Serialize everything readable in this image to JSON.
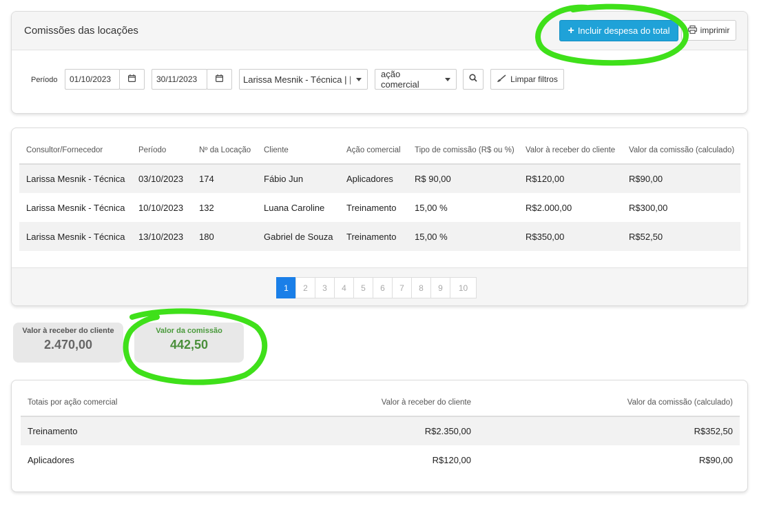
{
  "header": {
    "title": "Comissões das locações",
    "add_expense_label": "Incluir despesa do total",
    "print_label": "imprimir"
  },
  "filters": {
    "period_label": "Período",
    "start_date": "01/10/2023",
    "end_date": "30/11/2023",
    "consultant_select": "Larissa Mesnik - Técnica | |×",
    "action_select": "ação comercial",
    "clear_label": "Limpar filtros"
  },
  "table": {
    "columns": [
      "Consultor/Fornecedor",
      "Período",
      "Nº da Locação",
      "Cliente",
      "Ação comercial",
      "Tipo de comissão (R$ ou %)",
      "Valor à receber do cliente",
      "Valor da comissão (calculado)"
    ],
    "rows": [
      [
        "Larissa Mesnik - Técnica",
        "03/10/2023",
        "174",
        "Fábio Jun",
        "Aplicadores",
        "R$ 90,00",
        "R$120,00",
        "R$90,00"
      ],
      [
        "Larissa Mesnik - Técnica",
        "10/10/2023",
        "132",
        "Luana Caroline",
        "Treinamento",
        "15,00 %",
        "R$2.000,00",
        "R$300,00"
      ],
      [
        "Larissa Mesnik - Técnica",
        "13/10/2023",
        "180",
        "Gabriel de Souza",
        "Treinamento",
        "15,00 %",
        "R$350,00",
        "R$52,50"
      ]
    ]
  },
  "pagination": {
    "pages": [
      "1",
      "2",
      "3",
      "4",
      "5",
      "6",
      "7",
      "8",
      "9",
      "10"
    ],
    "current": "1"
  },
  "summary": {
    "receber_label": "Valor à receber do cliente",
    "receber_value": "2.470,00",
    "comissao_label": "Valor da comissão",
    "comissao_value": "442,50"
  },
  "totals": {
    "columns": [
      "Totais por ação comercial",
      "Valor à receber do cliente",
      "Valor da comissão (calculado)"
    ],
    "rows": [
      [
        "Treinamento",
        "R$2.350,00",
        "R$352,50"
      ],
      [
        "Aplicadores",
        "R$120,00",
        "R$90,00"
      ]
    ]
  },
  "colors": {
    "primary_button": "#1fa2d8",
    "pagination_active": "#1a7fe8",
    "commission_green": "#4a8f3a",
    "annotation_green": "#3fe01a"
  },
  "icons": {
    "add": "plus-icon",
    "print": "printer-icon",
    "calendar": "calendar-icon",
    "search": "search-icon",
    "clear": "brush-icon"
  }
}
